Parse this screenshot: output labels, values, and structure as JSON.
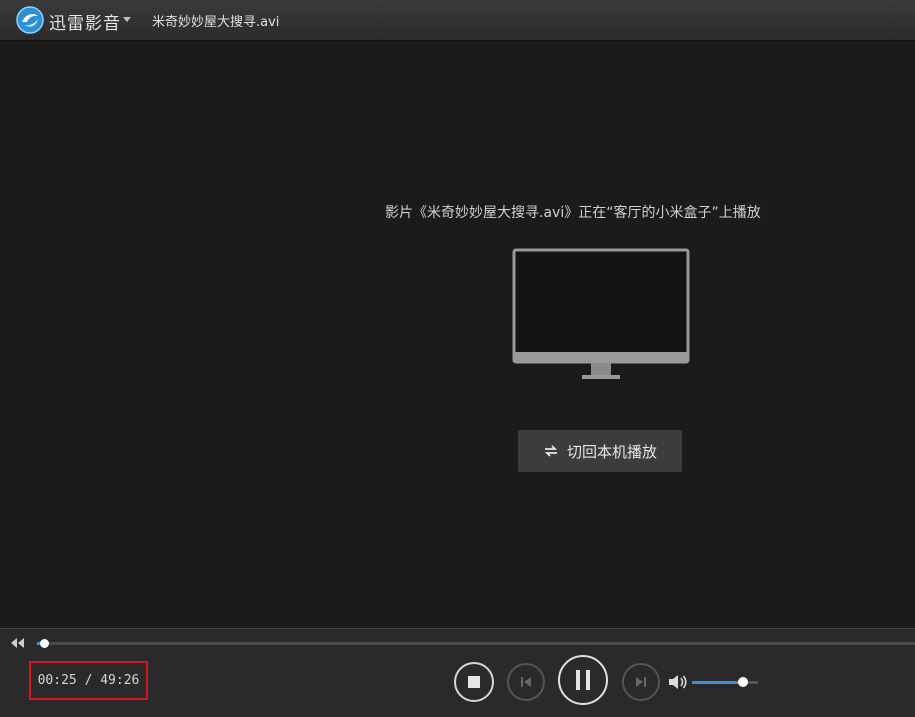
{
  "titlebar": {
    "app_name": "迅雷影音",
    "file_title": "米奇妙妙屋大搜寻.avi"
  },
  "player": {
    "cast_message": "影片《米奇妙妙屋大搜寻.avi》正在“客厅的小米盒子”上播放",
    "switch_button_label": "切回本机播放"
  },
  "controls": {
    "current_time": "00:25",
    "separator": " / ",
    "total_time": "49:26",
    "progress_fraction": 0.0085,
    "volume_fraction": 0.78,
    "accent_color": "#3d8fd9"
  },
  "icons": {
    "app_logo": "xunlei-logo-icon",
    "rewind": "rewind-icon",
    "stop": "stop-icon",
    "previous": "previous-icon",
    "pause": "pause-icon",
    "next": "next-icon",
    "volume": "volume-icon",
    "tv": "tv-icon",
    "switch": "switch-icon"
  }
}
